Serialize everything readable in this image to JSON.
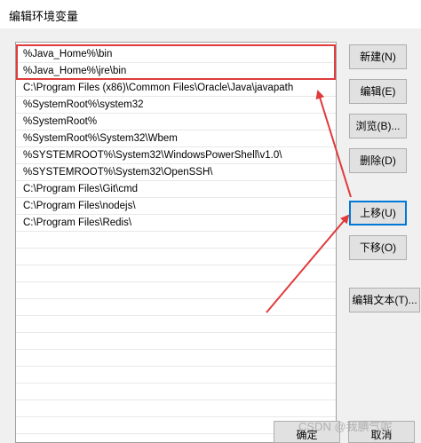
{
  "window": {
    "title": "编辑环境变量"
  },
  "paths": [
    "%Java_Home%\\bin",
    "%Java_Home%\\jre\\bin",
    "C:\\Program Files (x86)\\Common Files\\Oracle\\Java\\javapath",
    "%SystemRoot%\\system32",
    "%SystemRoot%",
    "%SystemRoot%\\System32\\Wbem",
    "%SYSTEMROOT%\\System32\\WindowsPowerShell\\v1.0\\",
    "%SYSTEMROOT%\\System32\\OpenSSH\\",
    "C:\\Program Files\\Git\\cmd",
    "C:\\Program Files\\nodejs\\",
    "C:\\Program Files\\Redis\\"
  ],
  "buttons": {
    "new": "新建(N)",
    "edit": "编辑(E)",
    "browse": "浏览(B)...",
    "delete": "删除(D)",
    "move_up": "上移(U)",
    "move_down": "下移(O)",
    "edit_text": "编辑文本(T)...",
    "ok": "确定",
    "cancel": "取消"
  },
  "watermark": "CSDN @我腆气呢",
  "colors": {
    "annotation": "#e03a3a",
    "focus_border": "#0078d7"
  }
}
